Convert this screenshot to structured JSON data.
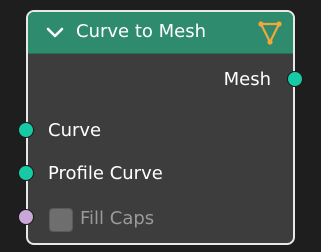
{
  "node": {
    "title": "Curve to Mesh",
    "header_color": "#2e8b6d",
    "icons": {
      "collapse": "chevron-down-icon",
      "type": "geometry-node-icon"
    },
    "outputs": [
      {
        "label": "Mesh",
        "socket_type": "geometry",
        "socket_color": "#17c9a4"
      }
    ],
    "inputs": [
      {
        "label": "Curve",
        "socket_type": "geometry",
        "socket_color": "#17c9a4"
      },
      {
        "label": "Profile Curve",
        "socket_type": "geometry",
        "socket_color": "#17c9a4"
      },
      {
        "label": "Fill Caps",
        "socket_type": "boolean",
        "socket_color": "#c8a6d8",
        "checked": false
      }
    ]
  }
}
